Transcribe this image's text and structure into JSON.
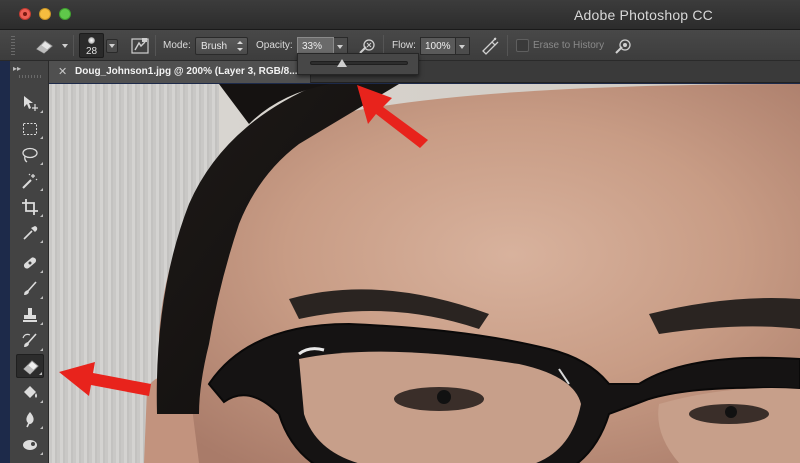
{
  "window": {
    "title": "Adobe Photoshop CC"
  },
  "options_bar": {
    "brush_size": "28",
    "mode_label": "Mode:",
    "mode_value": "Brush",
    "opacity_label": "Opacity:",
    "opacity_value": "33%",
    "flow_label": "Flow:",
    "flow_value": "100%",
    "erase_to_history_label": "Erase to History",
    "erase_to_history_checked": false
  },
  "opacity_slider": {
    "value_percent": 33
  },
  "document": {
    "tab_label": "Doug_Johnson1.jpg @ 200% (Layer 3, RGB/8..."
  },
  "tools": [
    {
      "name": "move-tool-icon",
      "active": false
    },
    {
      "name": "marquee-tool-icon",
      "active": false
    },
    {
      "name": "lasso-tool-icon",
      "active": false
    },
    {
      "name": "magic-wand-tool-icon",
      "active": false
    },
    {
      "name": "crop-tool-icon",
      "active": false
    },
    {
      "name": "eyedropper-tool-icon",
      "active": false
    },
    {
      "name": "healing-brush-tool-icon",
      "active": false
    },
    {
      "name": "brush-tool-icon",
      "active": false
    },
    {
      "name": "clone-stamp-tool-icon",
      "active": false
    },
    {
      "name": "history-brush-tool-icon",
      "active": false
    },
    {
      "name": "eraser-tool-icon",
      "active": true
    },
    {
      "name": "paint-bucket-tool-icon",
      "active": false
    },
    {
      "name": "blur-tool-icon",
      "active": false
    },
    {
      "name": "dodge-tool-icon",
      "active": false
    }
  ],
  "colors": {
    "annotation_arrow": "#e8231c",
    "ui_background": "#434343"
  }
}
